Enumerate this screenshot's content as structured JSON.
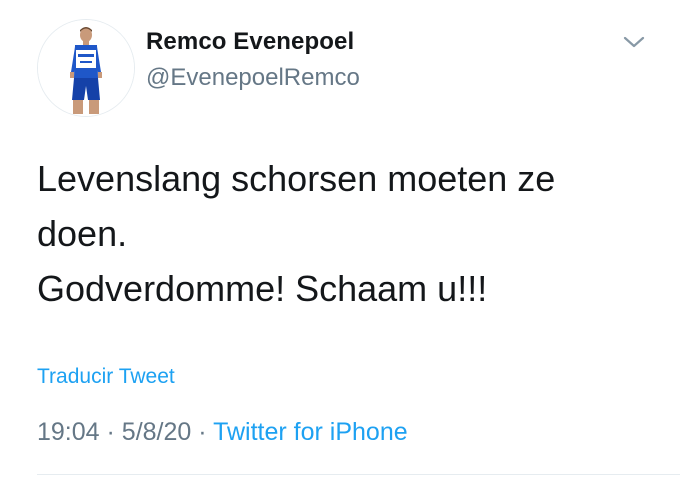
{
  "author": {
    "display_name": "Remco Evenepoel",
    "handle": "@EvenepoelRemco"
  },
  "tweet": {
    "lines": [
      "Levenslang schorsen moeten ze",
      "doen.",
      "Godverdomme! Schaam u!!!"
    ],
    "translate_label": "Traducir Tweet",
    "time": "19:04",
    "date": "5/8/20",
    "separator": "·",
    "source": "Twitter for iPhone"
  },
  "icons": {
    "menu": "chevron-down-icon",
    "avatar": "profile-photo"
  },
  "colors": {
    "link": "#1da1f2",
    "secondary": "#657786",
    "text": "#14171a",
    "divider": "#e6ecf0"
  }
}
